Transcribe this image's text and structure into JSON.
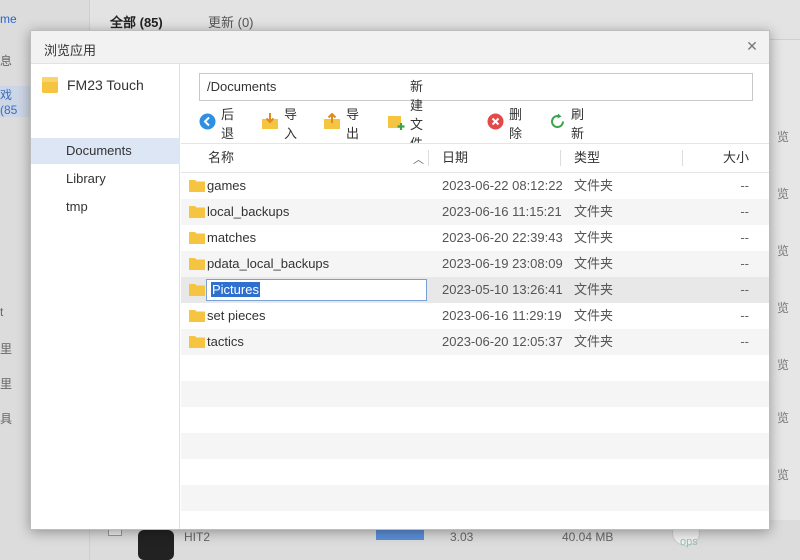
{
  "background": {
    "home_label": "me",
    "side_items": [
      "息",
      "戏 (85",
      "t",
      "里",
      "里",
      "具"
    ],
    "tabs": [
      {
        "label": "全部 (85)",
        "active": true
      },
      {
        "label": "更新 (0)",
        "active": false
      }
    ],
    "preview_label": "览",
    "bottom_row": {
      "name": "HIT2",
      "version": "3.03",
      "size": "40.04 MB"
    },
    "watermark": "ops"
  },
  "dialog": {
    "title": "浏览应用",
    "close_icon": "close-icon",
    "device_name": "FM23 Touch",
    "sidebar": [
      "Documents",
      "Library",
      "tmp"
    ],
    "selected_sidebar": "Documents",
    "path": "/Documents",
    "toolbar": [
      {
        "label": "后退",
        "icon": "back-icon",
        "color": "#2f8fe0"
      },
      {
        "label": "导入",
        "icon": "import-icon",
        "color": "#e8a93a"
      },
      {
        "label": "导出",
        "icon": "export-icon",
        "color": "#e8a93a"
      },
      {
        "label": "新建文件夹",
        "icon": "new-folder-icon",
        "color": "#3aa54a"
      },
      {
        "label": "删除",
        "icon": "delete-icon",
        "color": "#e24a4a"
      },
      {
        "label": "刷新",
        "icon": "refresh-icon",
        "color": "#3aa54a"
      }
    ],
    "columns": {
      "name": "名称",
      "date": "日期",
      "type": "类型",
      "size": "大小"
    },
    "files": [
      {
        "name": "games",
        "date": "2023-06-22 08:12:22",
        "type": "文件夹",
        "size": "--"
      },
      {
        "name": "local_backups",
        "date": "2023-06-16 11:15:21",
        "type": "文件夹",
        "size": "--"
      },
      {
        "name": "matches",
        "date": "2023-06-20 22:39:43",
        "type": "文件夹",
        "size": "--"
      },
      {
        "name": "pdata_local_backups",
        "date": "2023-06-19 23:08:09",
        "type": "文件夹",
        "size": "--"
      },
      {
        "name": "Pictures",
        "date": "2023-05-10 13:26:41",
        "type": "文件夹",
        "size": "--",
        "renaming": true
      },
      {
        "name": "set pieces",
        "date": "2023-06-16 11:29:19",
        "type": "文件夹",
        "size": "--"
      },
      {
        "name": "tactics",
        "date": "2023-06-20 12:05:37",
        "type": "文件夹",
        "size": "--"
      }
    ],
    "colors": {
      "folder": "#f5c542",
      "selection": "#dce6f4",
      "accent": "#2f6fce"
    }
  }
}
